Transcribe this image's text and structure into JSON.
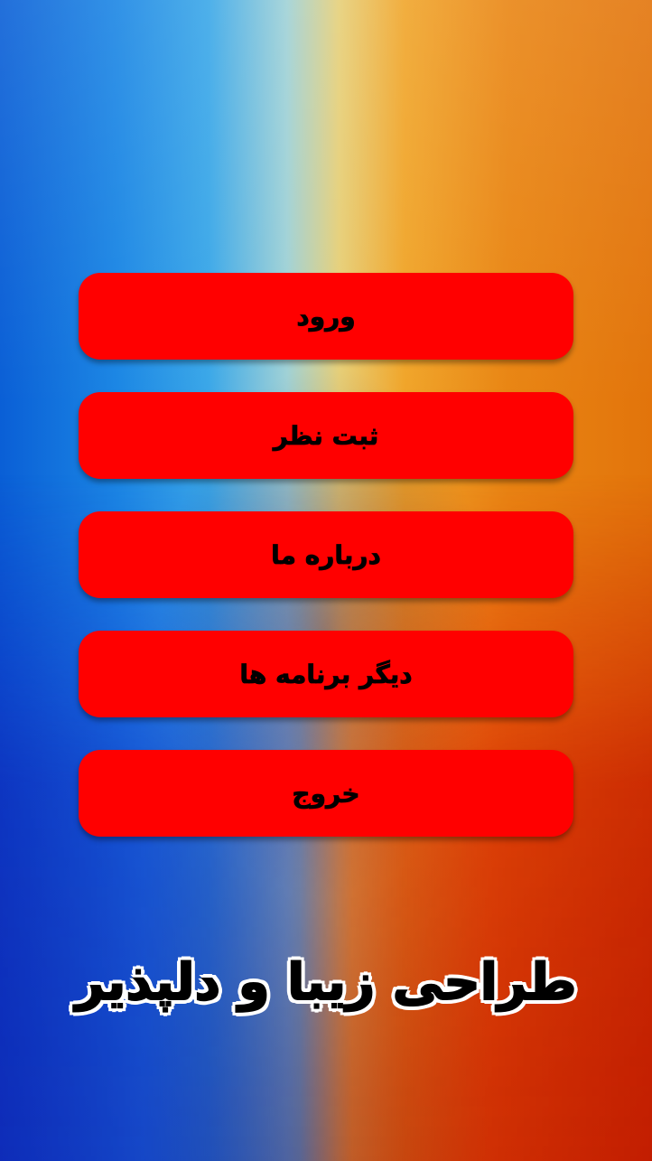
{
  "menu": {
    "items": [
      {
        "label": "ورود"
      },
      {
        "label": "ثبت نظر"
      },
      {
        "label": "درباره ما"
      },
      {
        "label": "دیگر برنامه ها"
      },
      {
        "label": "خروج"
      }
    ]
  },
  "footer": {
    "title": "طراحی زیبا و دلپذیر"
  },
  "colors": {
    "button_bg": "#ff0000",
    "button_text": "#000000",
    "title_text": "#000000",
    "title_outline": "#ffffff"
  }
}
